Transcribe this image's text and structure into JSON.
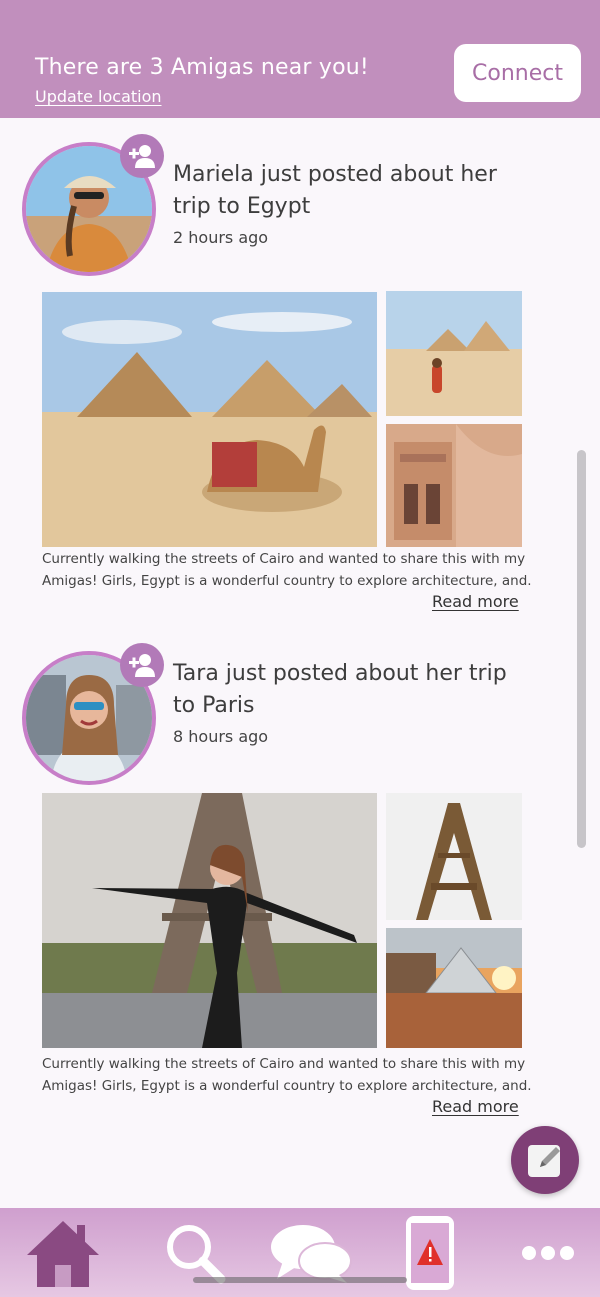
{
  "banner": {
    "title": "There are 3 Amigas near you!",
    "link": "Update location",
    "connect_label": "Connect"
  },
  "posts": [
    {
      "title": "Mariela just posted about her trip to Egypt",
      "time": "2 hours ago",
      "caption_line1": "Currently walking the streets of Cairo and wanted to share this with my",
      "caption_line2": "Amigas! Girls, Egypt is a wonderful country to explore architecture, and..",
      "read_more": "Read more"
    },
    {
      "title": "Tara just posted about her trip to Paris",
      "time": "8 hours ago",
      "caption_line1": "Currently walking the streets of Cairo and wanted to share this with my",
      "caption_line2": "Amigas! Girls, Egypt is a wonderful country to explore architecture, and..",
      "read_more": "Read more"
    }
  ],
  "nav": {
    "items": [
      "home-icon",
      "search-icon",
      "chat-icon",
      "alert-phone-icon",
      "more-icon"
    ]
  },
  "colors": {
    "brand": "#c18fbd",
    "accent": "#a86ea6",
    "nav_icon": "#8a4a82",
    "fab": "#7f3f76"
  }
}
